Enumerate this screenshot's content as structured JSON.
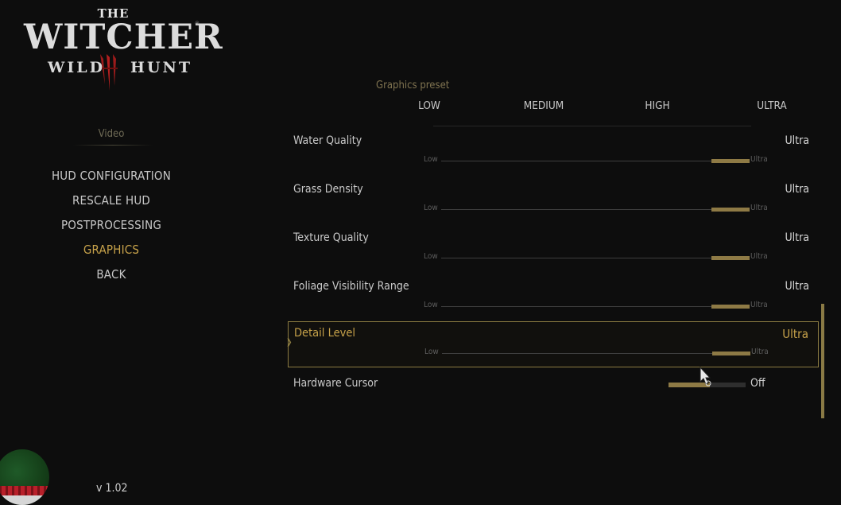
{
  "logo": {
    "the": "THE",
    "witcher": "WITCHER",
    "wild": "WILD",
    "hunt": "HUNT",
    "registered": "®"
  },
  "menu": {
    "section_label": "Video",
    "items": [
      {
        "label": "HUD CONFIGURATION"
      },
      {
        "label": "RESCALE HUD"
      },
      {
        "label": "POSTPROCESSING"
      },
      {
        "label": "GRAPHICS",
        "active": true
      },
      {
        "label": "BACK"
      }
    ]
  },
  "version": "v 1.02",
  "preset": {
    "title": "Graphics preset",
    "options": [
      "LOW",
      "MEDIUM",
      "HIGH",
      "ULTRA"
    ]
  },
  "settings": [
    {
      "label": "Water Quality",
      "value": "Ultra",
      "min": "Low",
      "max": "Ultra",
      "level": 1.0
    },
    {
      "label": "Grass Density",
      "value": "Ultra",
      "min": "Low",
      "max": "Ultra",
      "level": 1.0
    },
    {
      "label": "Texture Quality",
      "value": "Ultra",
      "min": "Low",
      "max": "Ultra",
      "level": 1.0
    },
    {
      "label": "Foliage Visibility Range",
      "value": "Ultra",
      "min": "Low",
      "max": "Ultra",
      "level": 1.0
    },
    {
      "label": "Detail Level",
      "value": "Ultra",
      "min": "Low",
      "max": "Ultra",
      "level": 1.0,
      "selected": true
    }
  ],
  "hardware_cursor": {
    "label": "Hardware Cursor",
    "value": "Off"
  },
  "colors": {
    "accent_gold": "#c7a24a",
    "slider_fill": "#8e7a45",
    "background": "#0d0d0d"
  }
}
